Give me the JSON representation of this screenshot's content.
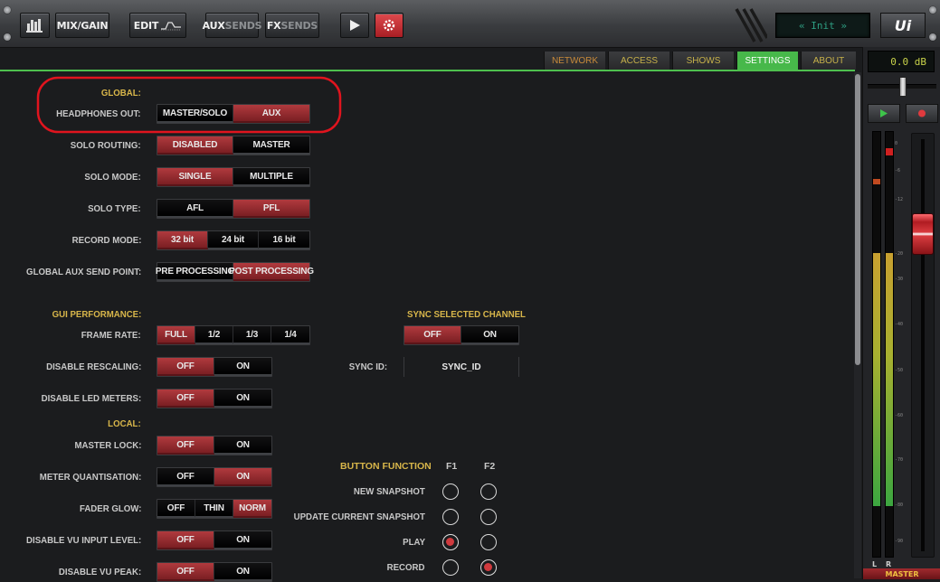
{
  "toolbar": {
    "mix_gain": "MIX/GAIN",
    "edit": "EDIT",
    "aux_a": "AUX",
    "aux_b": "SENDS",
    "fx_a": "FX",
    "fx_b": "SENDS",
    "display_text": "« Init »",
    "logo": "Ui"
  },
  "tabs": [
    "NETWORK",
    "ACCESS",
    "SHOWS",
    "SETTINGS",
    "ABOUT"
  ],
  "active_tab": "SETTINGS",
  "sections": {
    "global": "GLOBAL:",
    "gui_performance": "GUI PERFORMANCE:",
    "local": "LOCAL:",
    "sync_selected_channel": "SYNC SELECTED CHANNEL",
    "button_function": "BUTTON FUNCTION"
  },
  "settings": [
    {
      "label": "HEADPHONES OUT:",
      "options": [
        "MASTER/SOLO",
        "AUX"
      ],
      "selected": "AUX"
    },
    {
      "label": "SOLO ROUTING:",
      "options": [
        "DISABLED",
        "MASTER"
      ],
      "selected": "DISABLED"
    },
    {
      "label": "SOLO MODE:",
      "options": [
        "SINGLE",
        "MULTIPLE"
      ],
      "selected": "SINGLE"
    },
    {
      "label": "SOLO TYPE:",
      "options": [
        "AFL",
        "PFL"
      ],
      "selected": "PFL"
    },
    {
      "label": "RECORD MODE:",
      "options": [
        "32 bit",
        "24 bit",
        "16 bit"
      ],
      "selected": "32 bit"
    },
    {
      "label": "GLOBAL AUX SEND POINT:",
      "options": [
        "PRE PROCESSING",
        "POST PROCESSING"
      ],
      "selected": "POST PROCESSING"
    },
    {
      "label": "FRAME RATE:",
      "options": [
        "FULL",
        "1/2",
        "1/3",
        "1/4"
      ],
      "selected": "FULL"
    },
    {
      "label": "DISABLE RESCALING:",
      "options": [
        "OFF",
        "ON"
      ],
      "selected": "OFF"
    },
    {
      "label": "DISABLE LED METERS:",
      "options": [
        "OFF",
        "ON"
      ],
      "selected": "OFF"
    },
    {
      "label": "MASTER LOCK:",
      "options": [
        "OFF",
        "ON"
      ],
      "selected": "OFF"
    },
    {
      "label": "METER QUANTISATION:",
      "options": [
        "OFF",
        "ON"
      ],
      "selected": "ON"
    },
    {
      "label": "FADER GLOW:",
      "options": [
        "OFF",
        "THIN",
        "NORM"
      ],
      "selected": "NORM"
    },
    {
      "label": "DISABLE VU INPUT LEVEL:",
      "options": [
        "OFF",
        "ON"
      ],
      "selected": "OFF"
    },
    {
      "label": "DISABLE VU PEAK:",
      "options": [
        "OFF",
        "ON"
      ],
      "selected": "OFF"
    }
  ],
  "sync": {
    "options": [
      "OFF",
      "ON"
    ],
    "selected": "OFF",
    "id_label": "SYNC ID:",
    "id_value": "SYNC_ID"
  },
  "button_function": {
    "columns": [
      "F1",
      "F2"
    ],
    "rows": [
      {
        "label": "NEW SNAPSHOT",
        "f1": false,
        "f2": false
      },
      {
        "label": "UPDATE CURRENT SNAPSHOT",
        "f1": false,
        "f2": false
      },
      {
        "label": "PLAY",
        "f1": true,
        "f2": false
      },
      {
        "label": "RECORD",
        "f1": false,
        "f2": true
      }
    ]
  },
  "master": {
    "level": "0.0 dB",
    "meter_scale": [
      "0",
      "-6",
      "-12",
      "-20",
      "-30",
      "-40",
      "-50",
      "-60",
      "-70",
      "-80",
      "-90"
    ],
    "left_label": "L",
    "right_label": "R",
    "strip_label": "MASTER",
    "fader_position": 0.21
  },
  "colors": {
    "accent_green": "#47b84a",
    "active_red": "#9e2c31",
    "section_gold": "#d8b64a",
    "highlight_ring": "#e0141e"
  }
}
